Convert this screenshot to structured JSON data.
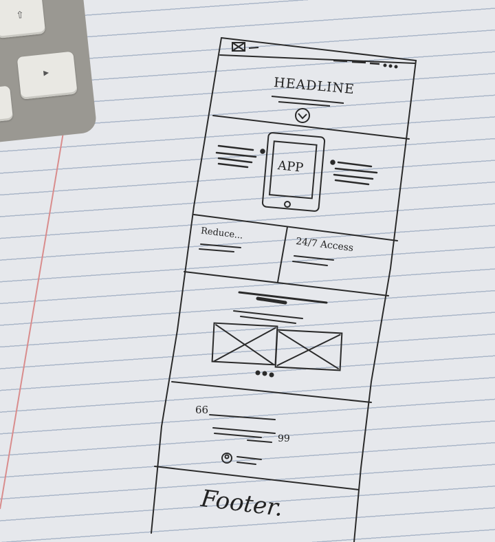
{
  "sketch": {
    "headline": "HEADLINE",
    "app_label": "APP",
    "feature_left": "Reduce...",
    "feature_right": "24/7 Access",
    "quote_open": "66",
    "quote_close": "99",
    "footer": "Footer."
  },
  "icons": {
    "keyboard_up_key": "up-arrow-key-icon",
    "keyboard_play_key": "play-key-icon",
    "logo_placeholder": "image-placeholder-icon",
    "scroll_down": "chevron-down-circle-icon",
    "avatar": "avatar-icon"
  },
  "colors": {
    "ink": "#2a2a2a",
    "paper": "#e6e8ec",
    "rule_line": "#aab6c8",
    "margin_line": "#d88a8a"
  }
}
